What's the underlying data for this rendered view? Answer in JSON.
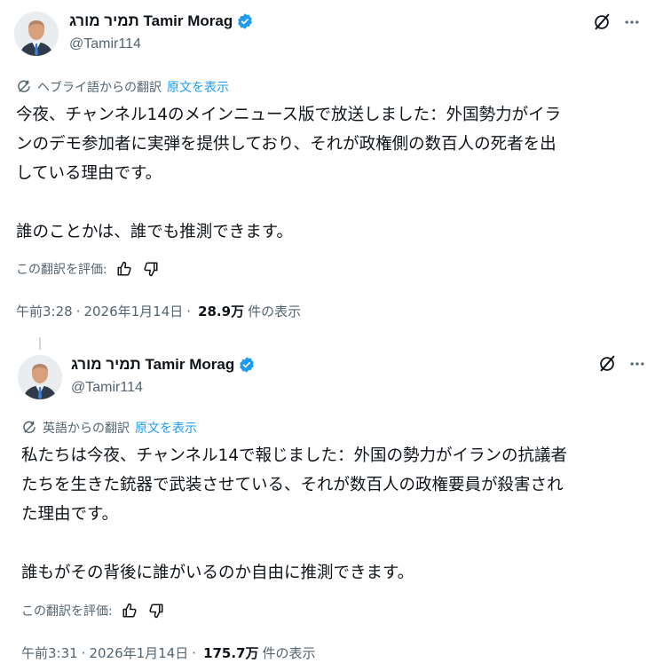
{
  "posts": [
    {
      "display_name": "תמיר מורג Tamir Morag",
      "handle": "@Tamir114",
      "translated_from": "ヘブライ語からの翻訳",
      "show_original": "原文を表示",
      "text": "今夜、チャンネル14のメインニュース版で放送しました：外国勢力がイラ\nンのデモ参加者に実弾を提供しており、それが政権側の数百人の死者を出\nしている理由です。\n\n誰のことかは、誰でも推測できます。",
      "rate_label": "この翻訳を評価:",
      "time": "午前3:28",
      "date": "2026年1月14日",
      "views_count": "28.9万",
      "views_label": "件の表示"
    },
    {
      "display_name": "תמיר מורג Tamir Morag",
      "handle": "@Tamir114",
      "translated_from": "英語からの翻訳",
      "show_original": "原文を表示",
      "text": "私たちは今夜、チャンネル14で報じました：外国の勢力がイランの抗議者\nたちを生きた銃器で武装させている、それが数百人の政権要員が殺害され\nた理由です。\n\n誰もがその背後に誰がいるのか自由に推測できます。",
      "rate_label": "この翻訳を評価:",
      "time": "午前3:31",
      "date": "2026年1月14日",
      "views_count": "175.7万",
      "views_label": "件の表示"
    }
  ],
  "separator": "·",
  "icons": {
    "verified": "verified-badge-icon",
    "grok": "grok-icon",
    "more": "more-icon",
    "translate": "translate-icon",
    "thumbs_up": "thumbs-up-icon",
    "thumbs_down": "thumbs-down-icon"
  },
  "colors": {
    "text": "#0f1419",
    "secondary": "#536471",
    "link": "#1d9bf0",
    "verified": "#1d9bf0"
  }
}
